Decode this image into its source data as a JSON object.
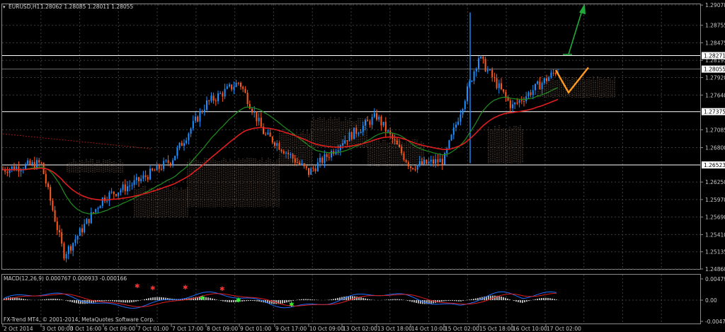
{
  "header": {
    "symbol": "EURUSD,H1",
    "ohlc": "1.28062 1.28085 1.28011 1.28055"
  },
  "macd_header": "MACD(12,26,9) 0.000767 0.000933 -0.000166",
  "copyright": "FX-Trend MT4, © 2001-2014, MetaQuotes Software Corp.",
  "price_axis": {
    "ticks": [
      "1.29078",
      "1.28755",
      "1.28475",
      "1.28195",
      "1.27920",
      "1.27640",
      "1.27085",
      "1.26800",
      "1.26250",
      "1.25970",
      "1.25690",
      "1.25410",
      "1.25135",
      "1.24860"
    ],
    "boxed": [
      "1.28271",
      "1.28055",
      "1.27375",
      "1.26523"
    ]
  },
  "macd_axis": {
    "ticks": [
      "0.004797",
      "0.00",
      "-0.004797"
    ]
  },
  "time_axis": {
    "labels": [
      "2 Oct 2014",
      "3 Oct 00:00",
      "3 Oct 16:00",
      "6 Oct 09:00",
      "7 Oct 01:00",
      "7 Oct 17:00",
      "8 Oct 09:00",
      "9 Oct 01:00",
      "9 Oct 17:00",
      "10 Oct 09:00",
      "13 Oct 02:00",
      "13 Oct 18:00",
      "14 Oct 10:00",
      "15 Oct 02:00",
      "15 Oct 18:00",
      "16 Oct 10:00",
      "17 Oct 02:00"
    ]
  },
  "colors": {
    "background": "#000000",
    "grid": "#3c3c3c",
    "bull": "#1e90ff",
    "bear": "#ff5a1e",
    "ema_fast": "#1f8f1f",
    "ema_slow": "#e01e1e",
    "cloud": "#e8b48c",
    "forecast_orange": "#ff9a1e",
    "forecast_green": "#1faa3a",
    "level_line": "#ffffff"
  },
  "chart_data": {
    "type": "candlestick",
    "title": "EURUSD,H1",
    "ylim": [
      1.2486,
      1.2908
    ],
    "horizontal_levels": [
      1.28271,
      1.27375,
      1.26523
    ],
    "current_price": 1.28055,
    "close_path": [
      {
        "x": "2 Oct 2014",
        "y": 1.2645
      },
      {
        "x": "3 Oct 00:00",
        "y": 1.2655
      },
      {
        "x": "3 Oct 06:00",
        "y": 1.251
      },
      {
        "x": "3 Oct 16:00",
        "y": 1.252
      },
      {
        "x": "6 Oct 09:00",
        "y": 1.26
      },
      {
        "x": "7 Oct 01:00",
        "y": 1.2625
      },
      {
        "x": "7 Oct 17:00",
        "y": 1.266
      },
      {
        "x": "8 Oct 09:00",
        "y": 1.275
      },
      {
        "x": "9 Oct 01:00",
        "y": 1.2785
      },
      {
        "x": "9 Oct 10:00",
        "y": 1.27
      },
      {
        "x": "9 Oct 17:00",
        "y": 1.269
      },
      {
        "x": "10 Oct 09:00",
        "y": 1.264
      },
      {
        "x": "10 Oct 20:00",
        "y": 1.2675
      },
      {
        "x": "13 Oct 02:00",
        "y": 1.269
      },
      {
        "x": "13 Oct 18:00",
        "y": 1.273
      },
      {
        "x": "14 Oct 10:00",
        "y": 1.265
      },
      {
        "x": "15 Oct 02:00",
        "y": 1.266
      },
      {
        "x": "15 Oct 18:00",
        "y": 1.2825
      },
      {
        "x": "16 Oct 10:00",
        "y": 1.2745
      },
      {
        "x": "17 Oct 02:00",
        "y": 1.2806
      }
    ]
  }
}
